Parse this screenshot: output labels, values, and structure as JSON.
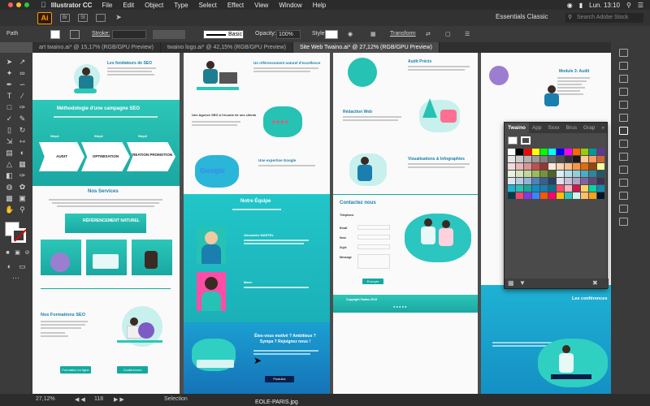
{
  "menubar": {
    "app_name": "Illustrator CC",
    "items": [
      "File",
      "Edit",
      "Object",
      "Type",
      "Select",
      "Effect",
      "View",
      "Window",
      "Help"
    ],
    "clock": "Lun. 13:10"
  },
  "appbar": {
    "logo": "Ai",
    "workspace": "Essentials Classic",
    "search_placeholder": "Search Adobe Stock"
  },
  "control": {
    "path_label": "Path",
    "stroke_label": "Stroke:",
    "brush_value": "Basic",
    "opacity_label": "Opacity:",
    "opacity_value": "100%",
    "style_label": "Style:",
    "transform_label": "Transform"
  },
  "tabs": [
    "art twaino.ai* @ 15,17% (RGB/GPU Preview)",
    "twaino logo.ai* @ 42,15% (RGB/GPU Preview)",
    "Site Web Twaino.ai* @ 27,12% (RGB/GPU Preview)"
  ],
  "artboard1": {
    "heading_top": "Les fondateurs de SEO",
    "band_title": "Méthodologie d'une campagne SEO",
    "steps": [
      "Step1",
      "Step2",
      "Step3"
    ],
    "chevrons": [
      "AUDIT",
      "OPTIMISATION",
      "CREATION PROMOTION"
    ],
    "services_title": "Nos Services",
    "referencement": "RÉFÉRENCEMENT NATUREL",
    "formations_title": "Nos Formations SEO",
    "btn1": "Formation en ligne",
    "btn2": "Conférences"
  },
  "artboard2": {
    "title1": "Un référencement naturel d'excellence",
    "agency": "Une Agence SEO à l'écoute de ses clients",
    "google_title": "Une expertise Google",
    "google_text": "Google",
    "team_title": "Notre Équipe",
    "member1": "Alexandre MARTEL",
    "member2": "Marie",
    "cta": "Êtes-vous motivé ? Ambitieux ? Sympa ? Rejoignez nous !",
    "cta_button": "Postulez"
  },
  "artboard3": {
    "audit": "Audit Précis",
    "redaction": "Rédaction Web",
    "infographics": "Visualisations & Infographies",
    "contact_title": "Contactez nous",
    "fields": [
      "Téléphone",
      "Email",
      "Nom",
      "Sujet",
      "Message"
    ],
    "submit": "Envoyer",
    "footer": "Copyright Twaino 2019"
  },
  "artboard4": {
    "module": "Module 3: Audit",
    "conferences": "Les conférences"
  },
  "swatches": {
    "tabs": [
      "Twaino",
      "App",
      "Sxxx",
      "Brus",
      "Grap"
    ],
    "colors": [
      "#ffffff",
      "#000000",
      "#ff0000",
      "#ffff00",
      "#00ff00",
      "#00ffff",
      "#0000ff",
      "#ff00ff",
      "#ff6600",
      "#99cc00",
      "#009999",
      "#663399",
      "#e6e6e6",
      "#cccccc",
      "#b3b3b3",
      "#999999",
      "#808080",
      "#666666",
      "#4d4d4d",
      "#333333",
      "#1a1a1a",
      "#ffcc99",
      "#ff9966",
      "#cc6633",
      "#f2dcdb",
      "#e6b8b7",
      "#da9694",
      "#c0504d",
      "#963634",
      "#fde9d9",
      "#fcd5b4",
      "#fabf8f",
      "#f79646",
      "#e26b0a",
      "#974706",
      "#ffff99",
      "#ebf1de",
      "#d8e4bc",
      "#c4d79b",
      "#9bbb59",
      "#76933c",
      "#4f6228",
      "#daeef3",
      "#b7dee8",
      "#92cddc",
      "#4bacc6",
      "#31869b",
      "#215967",
      "#dce6f1",
      "#b8cce4",
      "#95b3d7",
      "#4f81bd",
      "#366092",
      "#244062",
      "#e4dfec",
      "#ccc0da",
      "#b1a0c7",
      "#8064a2",
      "#60497a",
      "#403151",
      "#1fb2d4",
      "#26c2b4",
      "#15a9a0",
      "#0f8fc4",
      "#1a7fae",
      "#0b6e8f",
      "#ff4d6d",
      "#ffb3c1",
      "#c9184a",
      "#ffd166",
      "#06d6a0",
      "#118ab2",
      "#073b4c",
      "#ef476f",
      "#8338ec",
      "#3a86ff",
      "#fb5607",
      "#ff006e",
      "#ffbe0b",
      "#2ec4b6",
      "#cbf3f0",
      "#ffbf69",
      "#ff9f1c",
      "#011627"
    ]
  },
  "status": {
    "zoom": "27,12%",
    "page": "118",
    "tool": "Selection"
  },
  "caption": "EOLE-PARIS.jpg"
}
